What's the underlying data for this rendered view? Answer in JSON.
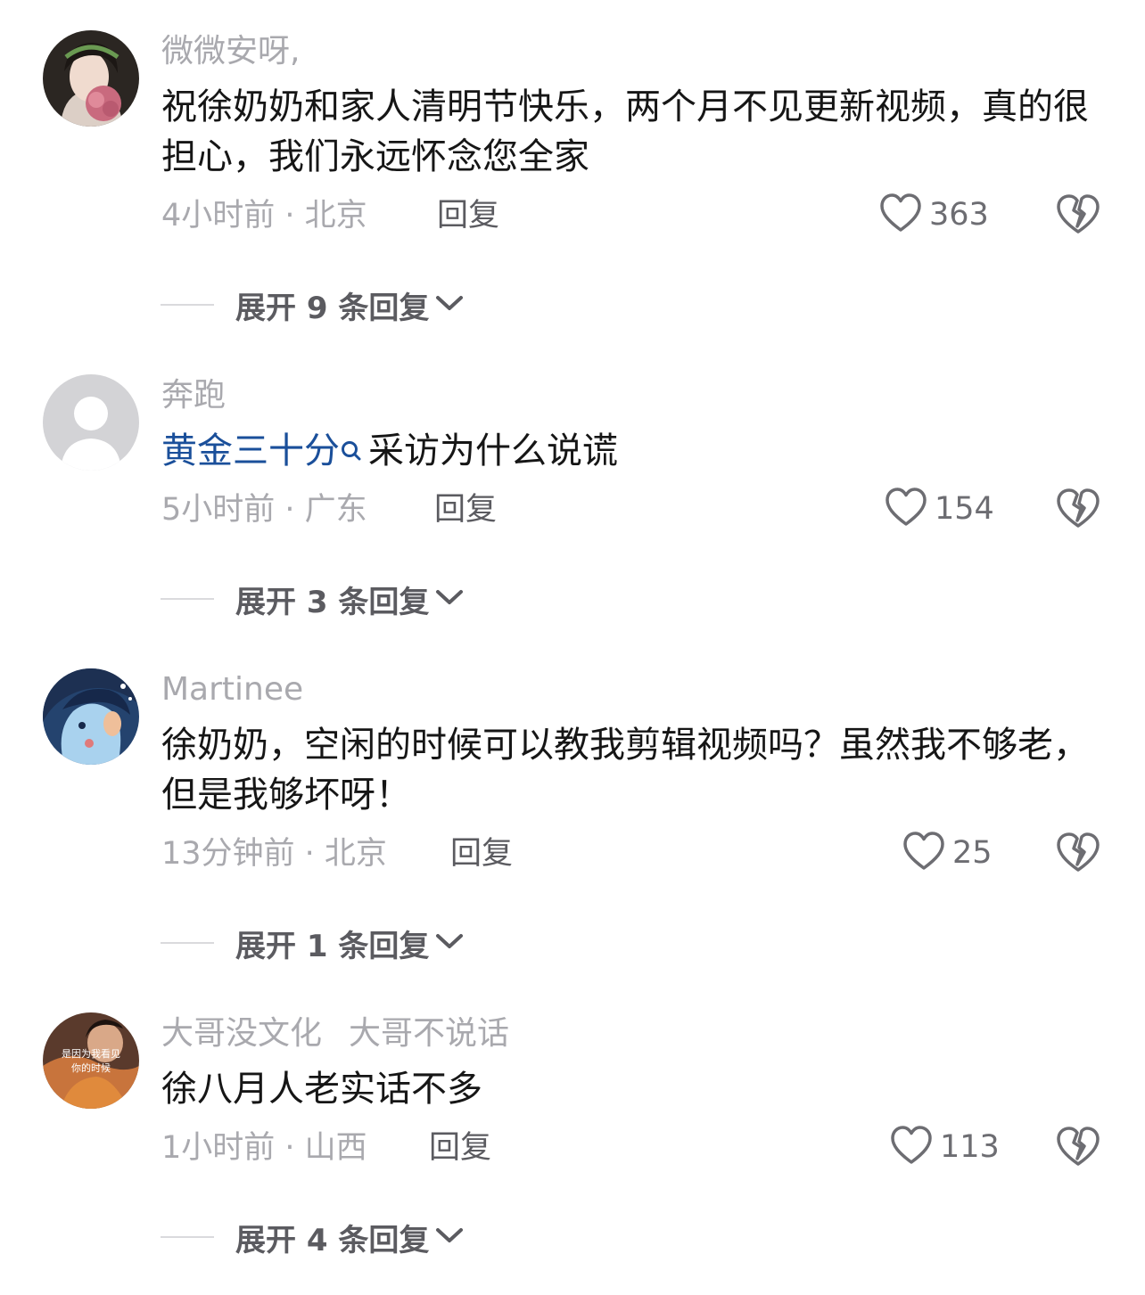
{
  "comments": [
    {
      "username": "微微安呀,",
      "text": "祝徐奶奶和家人清明节快乐，两个月不见更新视频，真的很担心，我们永远怀念您全家",
      "meta": "4小时前 · 北京",
      "reply_label": "回复",
      "likes": "363",
      "expand_label": "展开 9 条回复"
    },
    {
      "username": "奔跑",
      "link_text": "黄金三十分",
      "text": "采访为什么说谎",
      "meta": "5小时前 · 广东",
      "reply_label": "回复",
      "likes": "154",
      "expand_label": "展开 3 条回复"
    },
    {
      "username": "Martinee",
      "text": "徐奶奶，空闲的时候可以教我剪辑视频吗？虽然我不够老，但是我够坏呀！",
      "meta": "13分钟前 · 北京",
      "reply_label": "回复",
      "likes": "25",
      "expand_label": "展开 1 条回复"
    },
    {
      "username": "大哥没文化",
      "username_sub": "大哥不说话",
      "avatar_caption_1": "是因为我看见",
      "avatar_caption_2": "你的时候",
      "text": "徐八月人老实话不多",
      "meta": "1小时前 · 山西",
      "reply_label": "回复",
      "likes": "113",
      "expand_label": "展开 4 条回复"
    }
  ],
  "icons": {
    "like": "heart-outline-icon",
    "dislike": "broken-heart-icon",
    "expand": "chevron-down-icon",
    "search": "search-icon"
  },
  "colors": {
    "text": "#161616",
    "secondary": "#a9a9ae",
    "reply": "#5b5b60",
    "link": "#1a4f9a",
    "icon": "#6d6d72"
  }
}
